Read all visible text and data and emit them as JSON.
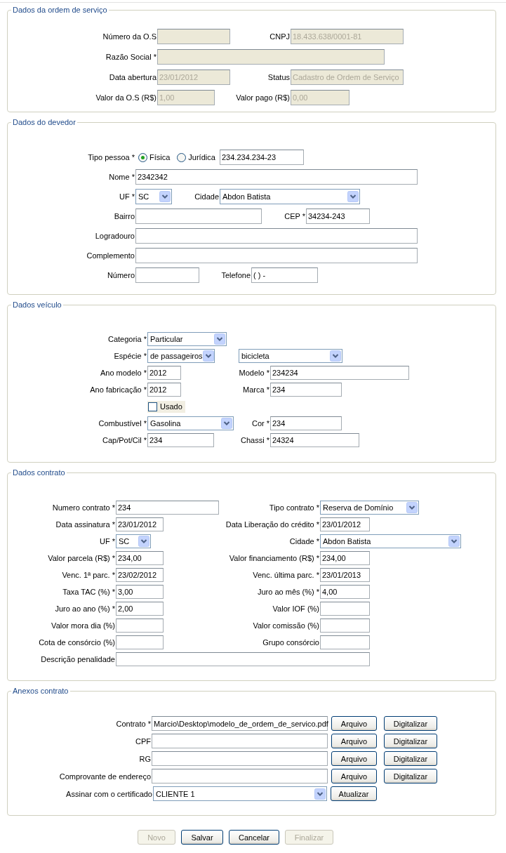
{
  "sections": [
    {
      "title": "Dados da ordem de serviço",
      "rows": [
        [
          {
            "kind": "text",
            "label": "Número da O.S",
            "disabled": true
          },
          {
            "kind": "text",
            "label": "CNPJ",
            "value": "18.433.638/0001-81",
            "disabled": true
          }
        ],
        [
          {
            "kind": "text",
            "label": "Razão Social *",
            "disabled": true
          }
        ],
        [
          {
            "kind": "text",
            "label": "Data abertura",
            "value": "23/01/2012",
            "disabled": true
          },
          {
            "kind": "text",
            "label": "Status",
            "value": "Cadastro de Ordem de Serviço",
            "disabled": true
          }
        ],
        [
          {
            "kind": "text",
            "label": "Valor da O.S (R$)",
            "value": "1,00",
            "disabled": true
          },
          {
            "kind": "text",
            "label": "Valor pago (R$)",
            "value": "0,00",
            "disabled": true
          }
        ]
      ]
    },
    {
      "title": "Dados do devedor",
      "rows": [
        [
          {
            "kind": "radio",
            "label": "Tipo pessoa *",
            "options": [
              {
                "label": "Física",
                "selected": true
              },
              {
                "label": "Jurídica",
                "selected": false
              }
            ]
          },
          {
            "kind": "text",
            "value": "234.234.234-23",
            "disabled": false
          }
        ],
        [
          {
            "kind": "text",
            "label": "Nome *",
            "value": "2342342",
            "disabled": false
          }
        ],
        [
          {
            "kind": "select",
            "label": "UF *",
            "value": "SC"
          },
          {
            "kind": "select",
            "label": "Cidade",
            "value": "Abdon Batista"
          }
        ],
        [
          {
            "kind": "text",
            "label": "Bairro",
            "disabled": false
          },
          {
            "kind": "text",
            "label": "CEP *",
            "value": "34234-243",
            "disabled": false
          }
        ],
        [
          {
            "kind": "text",
            "label": "Logradouro",
            "disabled": false
          }
        ],
        [
          {
            "kind": "text",
            "label": "Complemento",
            "disabled": false
          }
        ],
        [
          {
            "kind": "text",
            "label": "Número",
            "disabled": false
          },
          {
            "kind": "text",
            "label": "Telefone",
            "value": "( )   -",
            "disabled": false
          }
        ]
      ]
    },
    {
      "title": "Dados veículo",
      "rows": [
        [
          {
            "kind": "select",
            "label": "Categoria *",
            "value": "Particular"
          }
        ],
        [
          {
            "kind": "select",
            "label": "Espécie *",
            "value": "de passageiros"
          },
          {
            "kind": "select",
            "value": "bicicleta"
          }
        ],
        [
          {
            "kind": "text",
            "label": "Ano modelo *",
            "value": "2012",
            "disabled": false
          },
          {
            "kind": "text",
            "label": "Modelo *",
            "value": "234234",
            "disabled": false
          }
        ],
        [
          {
            "kind": "text",
            "label": "Ano fabricação *",
            "value": "2012",
            "disabled": false
          },
          {
            "kind": "text",
            "label": "Marca *",
            "value": "234",
            "disabled": false
          }
        ],
        [
          {
            "kind": "checkbox",
            "label": "Usado",
            "checked": false
          }
        ],
        [
          {
            "kind": "select",
            "label": "Combustível *",
            "value": "Gasolina"
          },
          {
            "kind": "text",
            "label": "Cor *",
            "value": "234",
            "disabled": false
          }
        ],
        [
          {
            "kind": "text",
            "label": "Cap/Pot/Cil *",
            "value": "234",
            "disabled": false
          },
          {
            "kind": "text",
            "label": "Chassi *",
            "value": "24324",
            "disabled": false
          }
        ]
      ]
    },
    {
      "title": "Dados contrato",
      "rows": [
        [
          {
            "kind": "text",
            "label": "Numero contrato *",
            "value": "234",
            "disabled": false
          },
          {
            "kind": "select",
            "label": "Tipo contrato *",
            "value": "Reserva de Domínio"
          }
        ],
        [
          {
            "kind": "text",
            "label": "Data assinatura *",
            "value": "23/01/2012",
            "disabled": false
          },
          {
            "kind": "text",
            "label": "Data Liberação do crédito *",
            "value": "23/01/2012",
            "disabled": false
          }
        ],
        [
          {
            "kind": "select",
            "label": "UF *",
            "value": "SC"
          },
          {
            "kind": "select",
            "label": "Cidade *",
            "value": "Abdon Batista"
          }
        ],
        [
          {
            "kind": "text",
            "label": "Valor parcela (R$) *",
            "value": "234,00",
            "disabled": false
          },
          {
            "kind": "text",
            "label": "Valor financiamento (R$) *",
            "value": "234,00",
            "disabled": false
          }
        ],
        [
          {
            "kind": "text",
            "label": "Venc. 1ª parc. *",
            "value": "23/02/2012",
            "disabled": false
          },
          {
            "kind": "text",
            "label": "Venc. última parc. *",
            "value": "23/01/2013",
            "disabled": false
          }
        ],
        [
          {
            "kind": "text",
            "label": "Taxa TAC (%) *",
            "value": "3,00",
            "disabled": false
          },
          {
            "kind": "text",
            "label": "Juro ao mês (%) *",
            "value": "4,00",
            "disabled": false
          }
        ],
        [
          {
            "kind": "text",
            "label": "Juro ao ano (%) *",
            "value": "2,00",
            "disabled": false
          },
          {
            "kind": "text",
            "label": "Valor IOF (%)",
            "disabled": false
          }
        ],
        [
          {
            "kind": "text",
            "label": "Valor mora dia (%)",
            "disabled": false
          },
          {
            "kind": "text",
            "label": "Valor comissão (%)",
            "disabled": false
          }
        ],
        [
          {
            "kind": "text",
            "label": "Cota de consórcio (%)",
            "disabled": false
          },
          {
            "kind": "text",
            "label": "Grupo consórcio",
            "disabled": false
          }
        ],
        [
          {
            "kind": "text",
            "label": "Descrição penalidade",
            "disabled": false
          }
        ]
      ]
    },
    {
      "title": "Anexos contrato",
      "rows": [
        [
          {
            "kind": "text",
            "label": "Contrato *",
            "value": "Marcio\\Desktop\\modelo_de_ordem_de_servico.pdf",
            "disabled": false
          },
          {
            "kind": "button",
            "label": "Arquivo",
            "disabled": false
          },
          {
            "kind": "button",
            "label": "Digitalizar",
            "disabled": false
          }
        ],
        [
          {
            "kind": "text",
            "label": "CPF",
            "disabled": false
          },
          {
            "kind": "button",
            "label": "Arquivo",
            "disabled": false
          },
          {
            "kind": "button",
            "label": "Digitalizar",
            "disabled": false
          }
        ],
        [
          {
            "kind": "text",
            "label": "RG",
            "disabled": false
          },
          {
            "kind": "button",
            "label": "Arquivo",
            "disabled": false
          },
          {
            "kind": "button",
            "label": "Digitalizar",
            "disabled": false
          }
        ],
        [
          {
            "kind": "text",
            "label": "Comprovante de endereço",
            "disabled": false
          },
          {
            "kind": "button",
            "label": "Arquivo",
            "disabled": false
          },
          {
            "kind": "button",
            "label": "Digitalizar",
            "disabled": false
          }
        ],
        [
          {
            "kind": "select",
            "label": "Assinar com o certificado",
            "value": "CLIENTE 1"
          },
          {
            "kind": "button",
            "label": "Atualizar",
            "disabled": false
          }
        ]
      ]
    }
  ],
  "actions": [
    {
      "label": "Novo",
      "disabled": true
    },
    {
      "label": "Salvar",
      "disabled": false
    },
    {
      "label": "Cancelar",
      "disabled": false
    },
    {
      "label": "Finalizar",
      "disabled": true
    }
  ]
}
